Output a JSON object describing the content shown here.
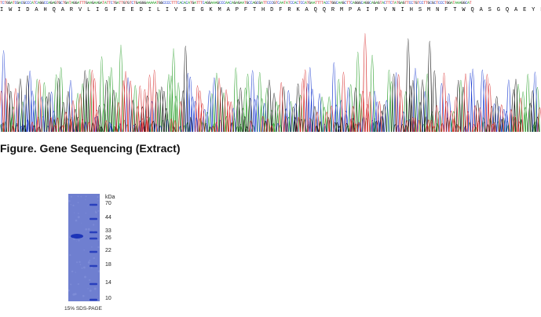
{
  "sequencing": {
    "dna": "TCTGGATCGACGCCCATCAGGCCAGAGTGCTGATAGGATTTGAAGAAGATATTCTGATTGTGTCTGAGGGAAAAATGGCCCCTTTCACACATGATTTCAGGAAAGCCCAACAGAGAATGCCAGCGATTCCCGTCAATATCCACTCCATGAATTTTACCTGGCAAGCTTCAGGGCAGGCAGAGTACTTCTATGAGTTCCTGTCCTTGCGCTCCCTGGATAAAGGCAT",
    "protein": "I W I D A H Q A R V L I G F E E D I L I V S E G K M A P F T H D F R K A Q Q R M P A I P V N I H S M N F T W Q A S G Q A E Y F Y E F L S L R S L D K G I",
    "base_colors": {
      "A": "#2ca02c",
      "C": "#1f3fd1",
      "G": "#111111",
      "T": "#d62728"
    }
  },
  "caption": "Figure. Gene Sequencing (Extract)",
  "gel": {
    "unit": "kDa",
    "markers": [
      "70",
      "44",
      "33",
      "26",
      "22",
      "18",
      "14",
      "10"
    ],
    "caption": "15% SDS-PAGE",
    "gel_color": "#6f7fd0",
    "band_color": "#1c34b8"
  }
}
